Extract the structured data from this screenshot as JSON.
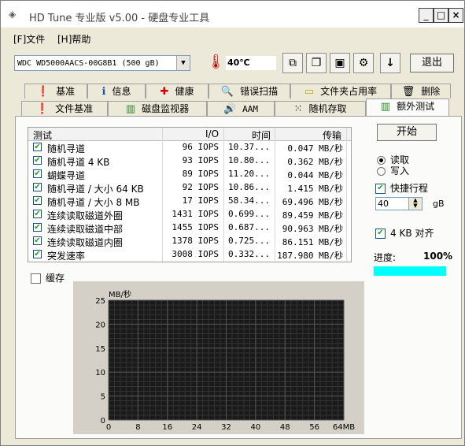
{
  "app": {
    "title": "HD Tune 专业版 v5.00 - 硬盘专业工具"
  },
  "window_controls": {
    "minimize": "_",
    "maximize": "□",
    "close": "×"
  },
  "menu": [
    {
      "label": "[F]文件"
    },
    {
      "label": "[H]帮助"
    }
  ],
  "toolbar": {
    "drive": "WDC WD5000AACS-00G8B1 (500 gB)",
    "temperature": "40℃",
    "exit_label": "退出"
  },
  "tabs_top": [
    {
      "label": "基准",
      "icon": "info-icon"
    },
    {
      "label": "信息",
      "icon": "info-icon"
    },
    {
      "label": "健康",
      "icon": "health-cross-icon"
    },
    {
      "label": "错误扫描",
      "icon": "magnifier-icon"
    },
    {
      "label": "文件夹占用率",
      "icon": "folder-icon"
    },
    {
      "label": "删除",
      "icon": "trash-icon"
    }
  ],
  "tabs_bottom": [
    {
      "label": "文件基准",
      "icon": "file-icon"
    },
    {
      "label": "磁盘监视器",
      "icon": "chart-icon"
    },
    {
      "label": "AAM",
      "icon": "speaker-icon"
    },
    {
      "label": "随机存取",
      "icon": "random-icon"
    },
    {
      "label": "额外测试",
      "icon": "extra-test-icon"
    }
  ],
  "table": {
    "headers": [
      "测试",
      "I/O",
      "时间",
      "传输"
    ],
    "rows": [
      {
        "test": "随机寻道",
        "io": "96 IOPS",
        "time": "10.37...",
        "transfer": "0.047 MB/秒"
      },
      {
        "test": "随机寻道 4 KB",
        "io": "93 IOPS",
        "time": "10.80...",
        "transfer": "0.362 MB/秒"
      },
      {
        "test": "蝴蝶寻道",
        "io": "89 IOPS",
        "time": "11.20...",
        "transfer": "0.044 MB/秒"
      },
      {
        "test": "随机寻道 / 大小 64 KB",
        "io": "92 IOPS",
        "time": "10.86...",
        "transfer": "1.415 MB/秒"
      },
      {
        "test": "随机寻道 / 大小 8 MB",
        "io": "17 IOPS",
        "time": "58.34...",
        "transfer": "69.496 MB/秒"
      },
      {
        "test": "连续读取磁道外圈",
        "io": "1431 IOPS",
        "time": "0.699...",
        "transfer": "89.459 MB/秒"
      },
      {
        "test": "连续读取磁道中部",
        "io": "1455 IOPS",
        "time": "0.687...",
        "transfer": "90.963 MB/秒"
      },
      {
        "test": "连续读取磁道内圈",
        "io": "1378 IOPS",
        "time": "0.725...",
        "transfer": "86.151 MB/秒"
      },
      {
        "test": "突发速率",
        "io": "3008 IOPS",
        "time": "0.332...",
        "transfer": "187.980 MB/秒"
      }
    ]
  },
  "cache_label": "缓存",
  "right_panel": {
    "start_label": "开始",
    "read_label": "读取",
    "write_label": "写入",
    "short_stroke_label": "快捷行程",
    "short_stroke_value": "40",
    "short_stroke_unit": "gB",
    "align_label": "4 KB 对齐",
    "progress_label": "进度:",
    "progress_value": "100%",
    "progress_fraction": 1.0
  },
  "chart_data": {
    "type": "line",
    "ylabel": "MB/秒",
    "ylim": [
      0,
      25
    ],
    "xlim": [
      0,
      64
    ],
    "y_ticks": [
      "0",
      "5",
      "10",
      "15",
      "20",
      "25"
    ],
    "x_ticks": [
      "0",
      "8",
      "16",
      "24",
      "32",
      "40",
      "48",
      "56",
      "64MB"
    ],
    "grid": true,
    "series": []
  },
  "colors": {
    "progress": "#00ffff",
    "chart_bg": "#1a1a1a",
    "chart_grid": "#555555"
  }
}
